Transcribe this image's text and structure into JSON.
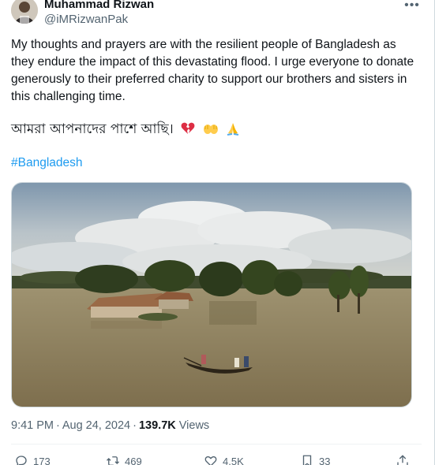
{
  "author": {
    "name": "Muhammad Rizwan",
    "handle": "@iMRizwanPak"
  },
  "tweet": {
    "text": "My thoughts and prayers are with the resilient people of Bangladesh as they endure the impact of this devastating flood. I urge everyone to donate generously to their preferred charity to support our brothers and sisters in this challenging time.",
    "bangla": "আমরা আপনাদের পাশে আছি।",
    "emojis": [
      "broken-heart-emoji",
      "open-hands-emoji",
      "folded-hands-emoji"
    ],
    "hashtag": "#Bangladesh"
  },
  "media": {
    "icon": "flood-photo"
  },
  "meta": {
    "time": "9:41 PM",
    "date": "Aug 24, 2024",
    "views_count": "139.7K",
    "views_label": "Views"
  },
  "actions": {
    "replies": "173",
    "retweets": "469",
    "likes": "4.5K",
    "bookmarks": "33"
  },
  "colors": {
    "accent": "#1d9bf0",
    "text": "#0f1419",
    "secondary": "#536471"
  }
}
